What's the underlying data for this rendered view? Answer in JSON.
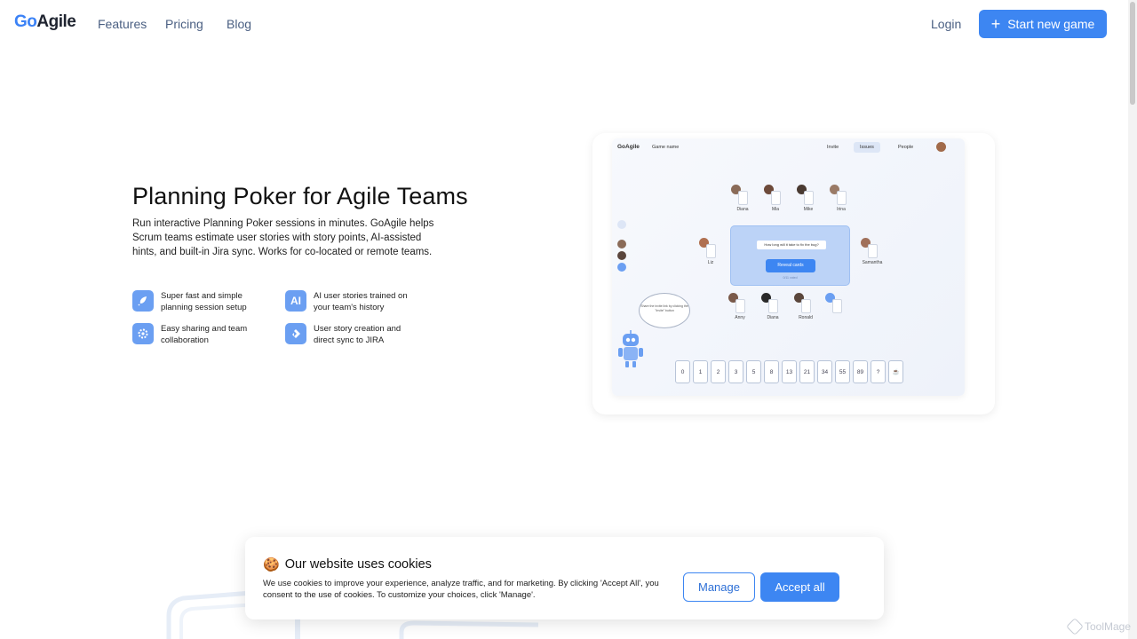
{
  "header": {
    "logo_prefix": "Go",
    "logo_suffix": "Agile",
    "nav": [
      "Features",
      "Pricing",
      "Blog"
    ],
    "login_label": "Login",
    "cta_label": "Start new game"
  },
  "hero": {
    "title": "Planning Poker for Agile Teams",
    "description": "Run interactive Planning Poker sessions in minutes. GoAgile helps Scrum teams estimate user stories with story points, AI-assisted hints, and built-in Jira sync. Works for co-located or remote teams.",
    "features": [
      {
        "icon": "rocket-icon",
        "text": "Super fast and simple planning session setup"
      },
      {
        "icon": "ai-icon",
        "icon_text": "AI",
        "text": "AI user stories trained on your team's history"
      },
      {
        "icon": "gear-icon",
        "text": "Easy sharing and team collaboration"
      },
      {
        "icon": "jira-icon",
        "text": "User story creation and direct sync to JIRA"
      }
    ]
  },
  "preview": {
    "logo": "GoAgile",
    "game_name": "Game name",
    "invite": "Invite",
    "issues": "Issues",
    "people": "People",
    "question": "How long will it take to fix the bug?",
    "reveal": "Reveal cards",
    "vote_status": "0/11 voted",
    "players_top": [
      "Diana",
      "Mia",
      "Mike",
      "Irina"
    ],
    "player_left": "Liz",
    "player_right": "Samantha",
    "players_bottom": [
      "Anny",
      "Diana",
      "Ronald"
    ],
    "bubble_text": "Share the invite link by clicking the \"Invite\" button",
    "cards": [
      "0",
      "1",
      "2",
      "3",
      "5",
      "8",
      "13",
      "21",
      "34",
      "55",
      "89",
      "?",
      "☕"
    ]
  },
  "cookie": {
    "title": "Our website uses cookies",
    "icon": "cookie-icon",
    "text": "We use cookies to improve your experience, analyze traffic, and for marketing. By clicking 'Accept All', you consent to the use of cookies. To customize your choices, click 'Manage'.",
    "manage_label": "Manage",
    "accept_label": "Accept all"
  },
  "watermark": "ToolMage",
  "colors": {
    "accent": "#3d86f2",
    "nav_text": "#4a5f82"
  }
}
